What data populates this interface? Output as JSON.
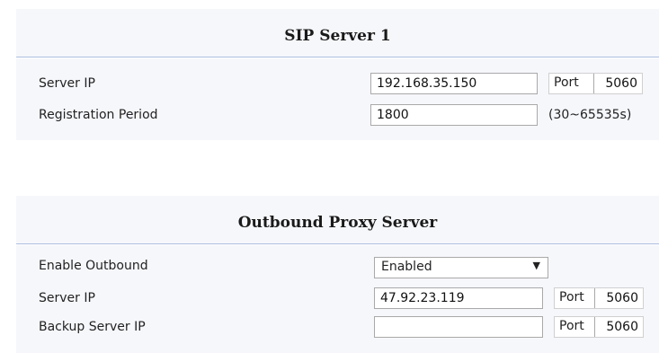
{
  "sip_server": {
    "title": "SIP Server 1",
    "server_ip_label": "Server IP",
    "server_ip_value": "192.168.35.150",
    "port_label": "Port",
    "port_value": "5060",
    "registration_label": "Registration Period",
    "registration_value": "1800",
    "registration_hint": "(30~65535s)"
  },
  "outbound_proxy": {
    "title": "Outbound Proxy Server",
    "enable_label": "Enable Outbound",
    "enable_value": "Enabled",
    "server_ip_label": "Server IP",
    "server_ip_value": "47.92.23.119",
    "server_port_label": "Port",
    "server_port_value": "5060",
    "backup_ip_label": "Backup Server IP",
    "backup_ip_value": "",
    "backup_port_label": "Port",
    "backup_port_value": "5060"
  }
}
